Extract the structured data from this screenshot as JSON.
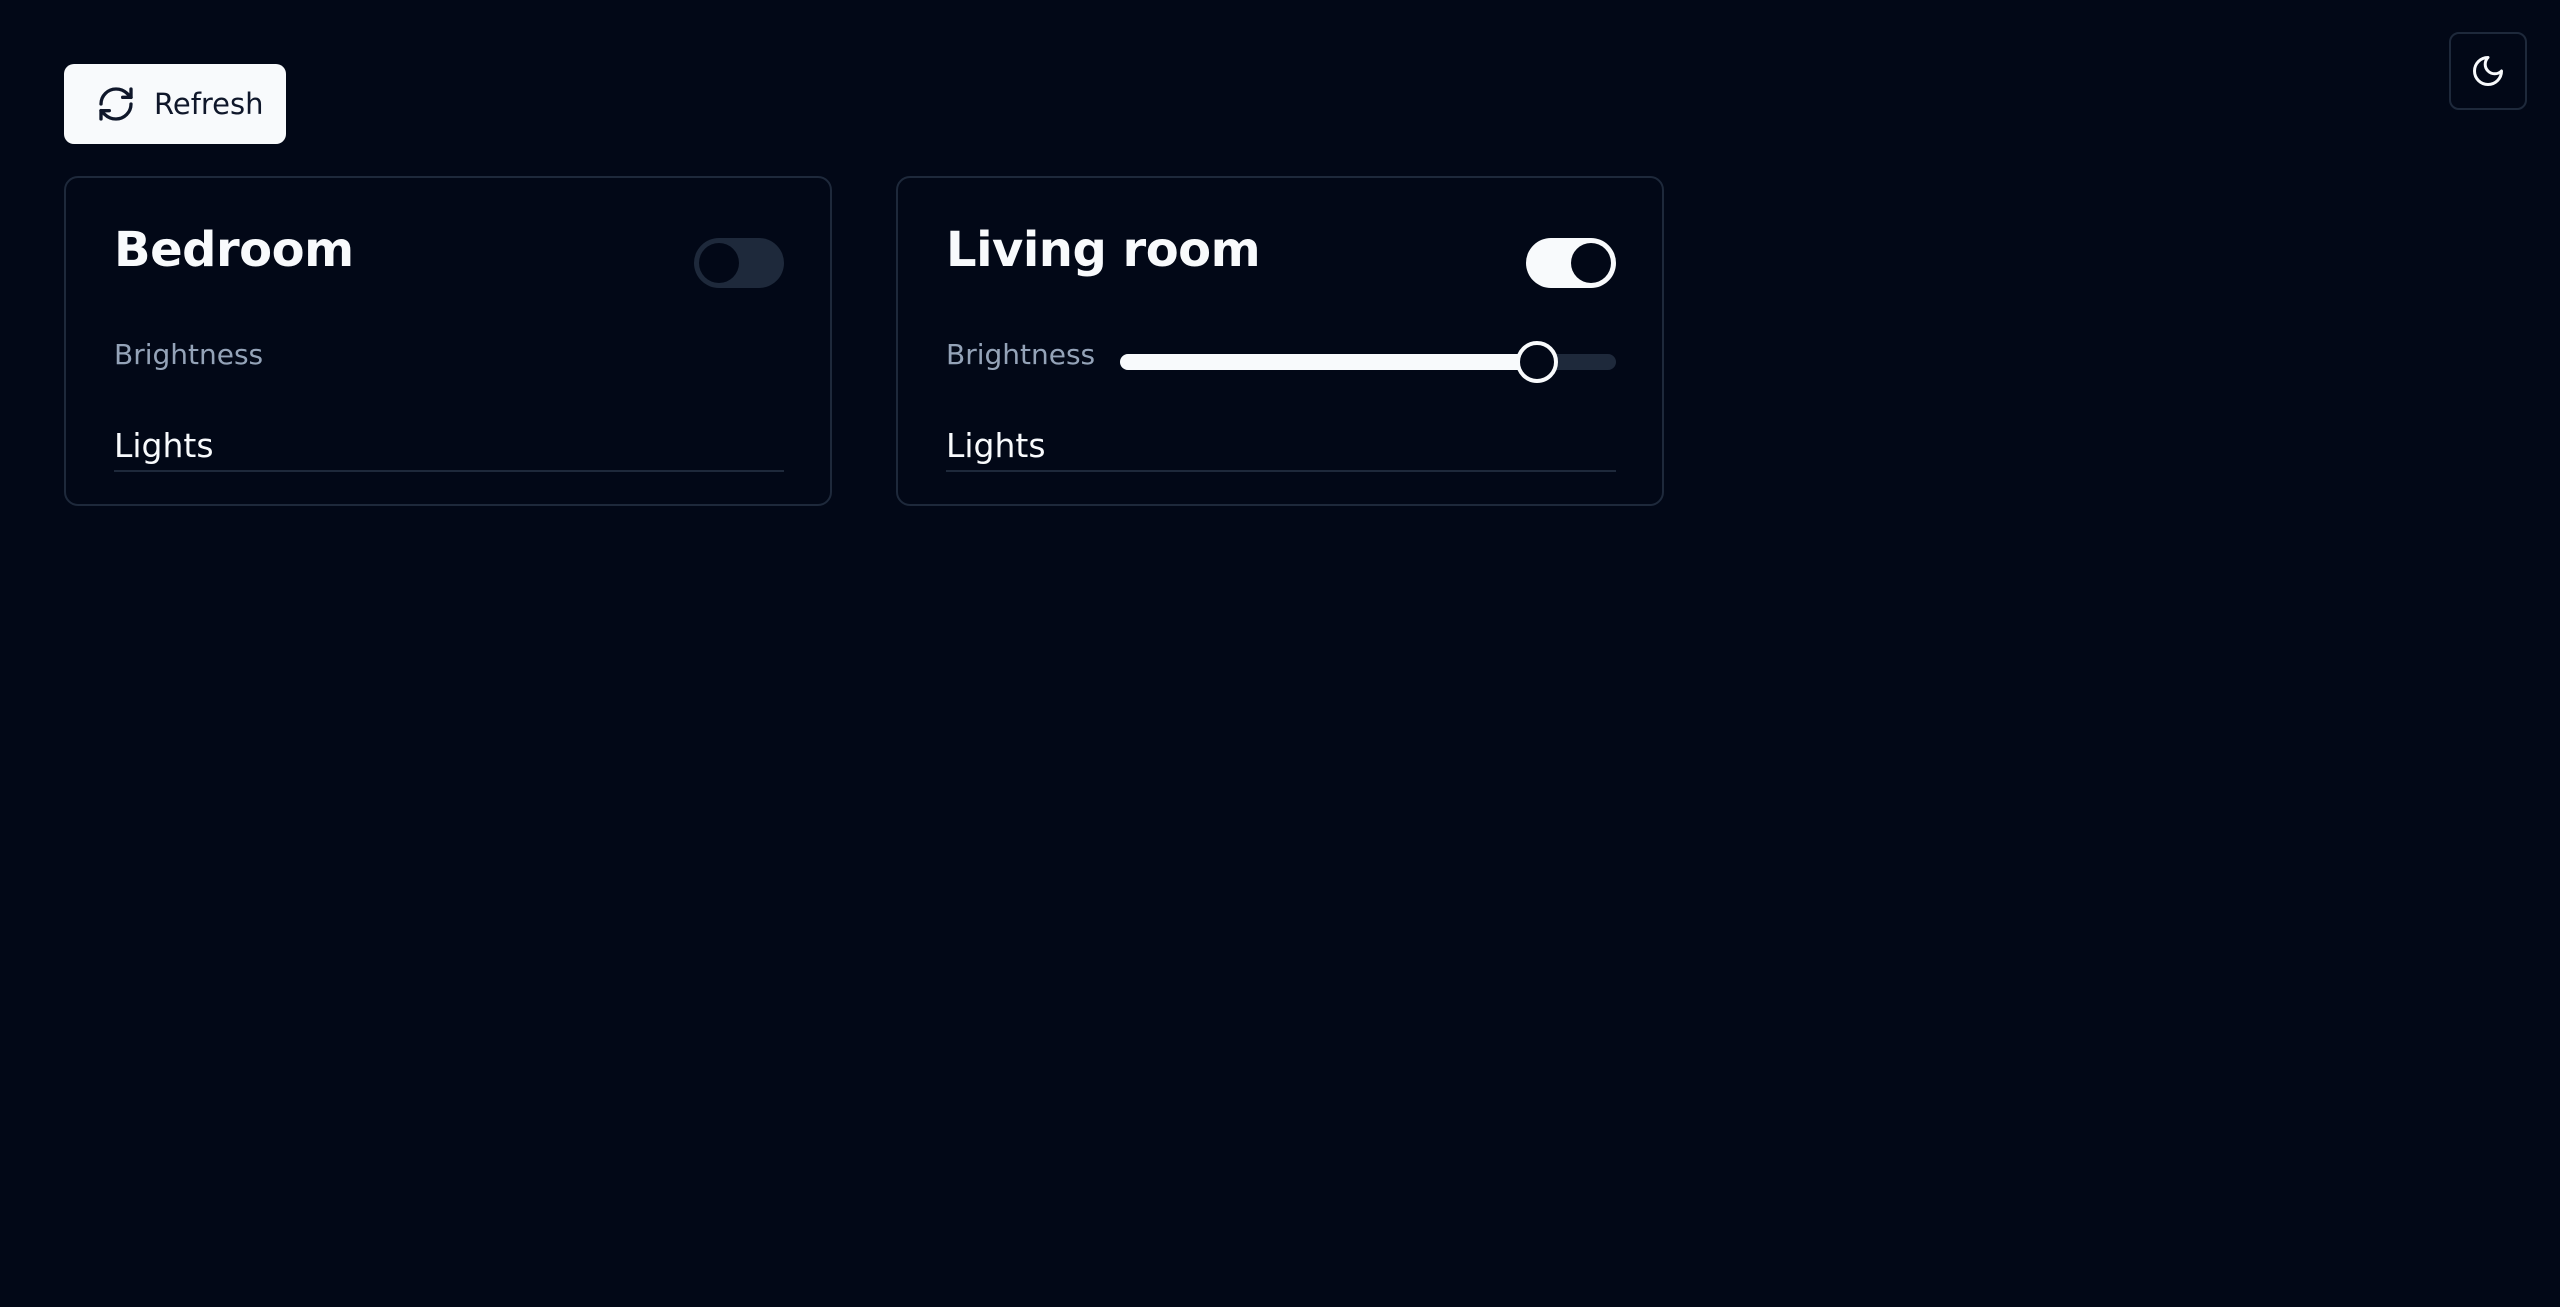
{
  "toolbar": {
    "refresh_label": "Refresh",
    "refresh_icon": "refresh-icon",
    "theme_icon": "moon-icon"
  },
  "colors": {
    "background": "#020817",
    "foreground": "#f8fafc",
    "muted": "#94a3b8",
    "border": "#1e293b"
  },
  "rooms": [
    {
      "name": "Bedroom",
      "power_on": false,
      "brightness_label": "Brightness",
      "lights_label": "Lights"
    },
    {
      "name": "Living room",
      "power_on": true,
      "brightness_label": "Brightness",
      "brightness_value": 0.84,
      "lights_label": "Lights"
    }
  ]
}
